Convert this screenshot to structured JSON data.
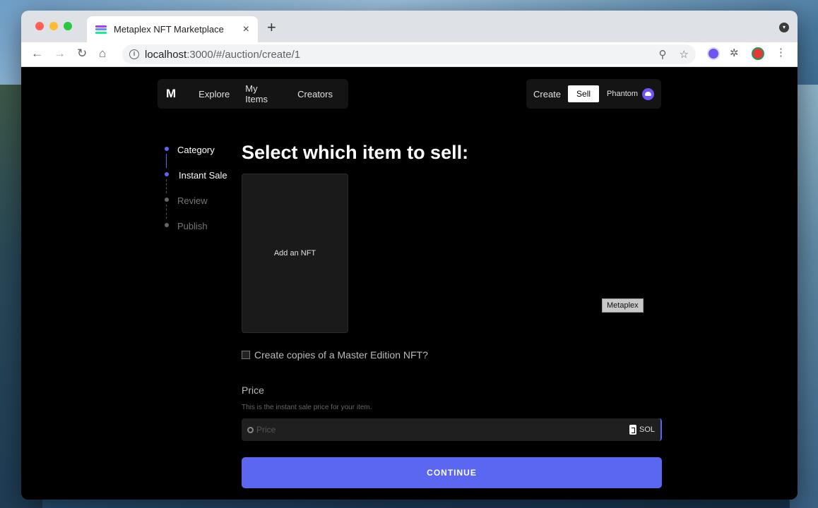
{
  "browser": {
    "tab_title": "Metaplex NFT Marketplace",
    "tab_close": "×",
    "new_tab": "+",
    "url_host": "localhost",
    "url_path": ":3000/#/auction/create/1"
  },
  "navbar": {
    "logo": "M",
    "links": [
      "Explore",
      "My Items",
      "Creators"
    ],
    "create": "Create",
    "sell": "Sell",
    "wallet": "Phantom"
  },
  "steps": [
    {
      "label": "Category",
      "state": "active"
    },
    {
      "label": "Instant Sale",
      "state": "active"
    },
    {
      "label": "Review",
      "state": "inactive"
    },
    {
      "label": "Publish",
      "state": "inactive"
    }
  ],
  "main": {
    "title": "Select which item to sell:",
    "add_nft": "Add an NFT",
    "tooltip": "Metaplex",
    "checkbox_label": "Create copies of a Master Edition NFT?",
    "price_label": "Price",
    "price_help": "This is the instant sale price for your item.",
    "price_placeholder": "Price",
    "currency": "SOL",
    "continue": "CONTINUE"
  },
  "colors": {
    "accent": "#5b67f0",
    "background": "#000000"
  }
}
